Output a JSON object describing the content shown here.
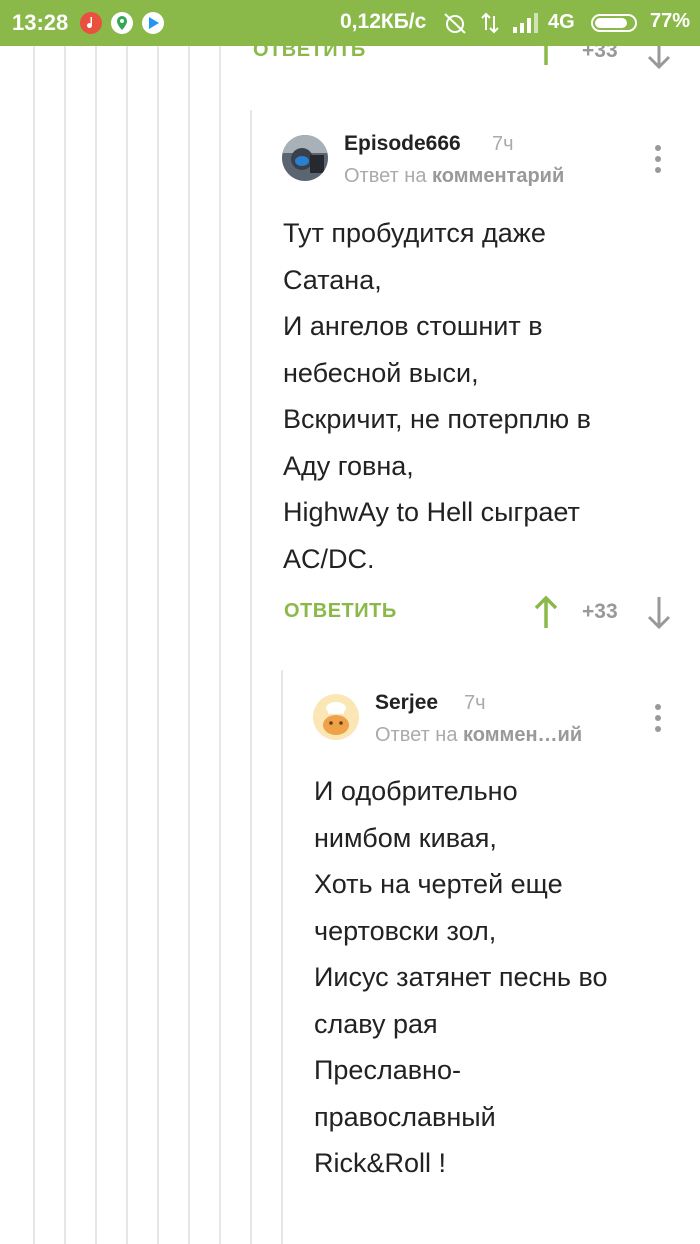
{
  "status_bar": {
    "time": "13:28",
    "network_speed": "0,12КБ/с",
    "network_type": "4G",
    "battery_percent": "77%"
  },
  "top_actions": {
    "reply_label": "ОТВЕТИТЬ",
    "score": "+33"
  },
  "comment1": {
    "username": "Episode666",
    "time": "7ч",
    "reply_prefix": "Ответ на",
    "reply_target": "комментарий",
    "lines": [
      "Тут пробудится даже",
      "Сатана,",
      "И ангелов стошнит в",
      "небесной выси,",
      "Вскричит, не потерплю в",
      "Аду говна,",
      "HighwAy to Hell сыграет",
      "AC/DC."
    ],
    "reply_label": "ОТВЕТИТЬ",
    "score": "+33"
  },
  "comment2": {
    "username": "Serjee",
    "time": "7ч",
    "reply_prefix": "Ответ на",
    "reply_target": "коммен…ий",
    "lines": [
      "И одобрительно",
      "нимбом кивая,",
      "Хоть на чертей еще",
      "чертовски зол,",
      "Иисус затянет песнь во",
      "славу рая",
      "Преславно-",
      "православный",
      "Rick&Roll !"
    ]
  },
  "colors": {
    "accent_green": "#8ab94a",
    "muted_gray": "#999999"
  }
}
